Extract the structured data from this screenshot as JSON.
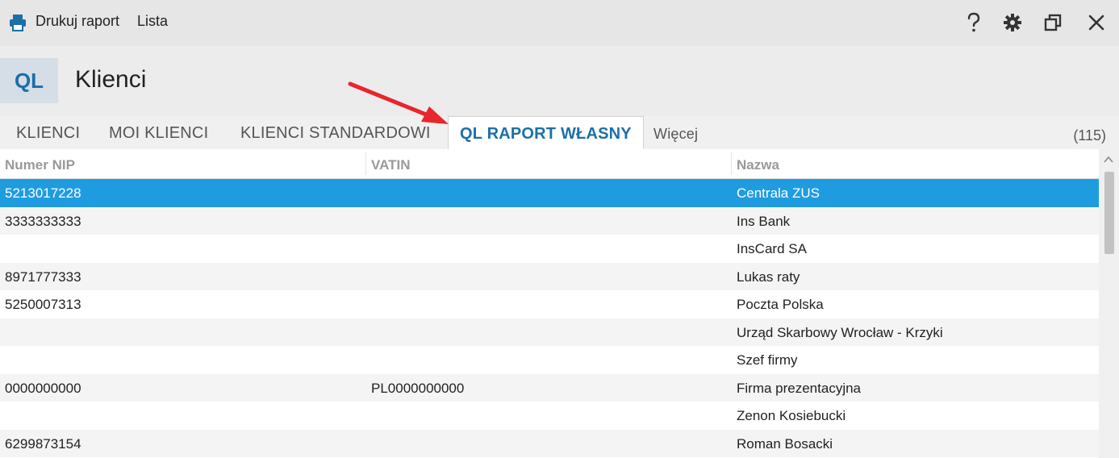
{
  "toolbar": {
    "print_label": "Drukuj raport",
    "list_label": "Lista",
    "print_icon": "printer-icon",
    "help_icon": "help-icon",
    "settings_icon": "gear-icon",
    "restore_icon": "restore-window-icon",
    "close_icon": "close-icon"
  },
  "header": {
    "badge": "QL",
    "title": "Klienci"
  },
  "tabs": {
    "items": [
      "KLIENCI",
      "MOI KLIENCI",
      "KLIENCI STANDARDOWI",
      "QL RAPORT WŁASNY"
    ],
    "active_index": 3,
    "more_label": "Więcej",
    "count": "(115)"
  },
  "table": {
    "columns": [
      "Numer NIP",
      "VATIN",
      "Nazwa"
    ],
    "rows": [
      {
        "nip": "5213017228",
        "vatin": "",
        "name": "Centrala ZUS",
        "selected": true
      },
      {
        "nip": "3333333333",
        "vatin": "",
        "name": "Ins Bank"
      },
      {
        "nip": "",
        "vatin": "",
        "name": "InsCard SA"
      },
      {
        "nip": "8971777333",
        "vatin": "",
        "name": "Lukas raty"
      },
      {
        "nip": "5250007313",
        "vatin": "",
        "name": "Poczta Polska"
      },
      {
        "nip": "",
        "vatin": "",
        "name": "Urząd Skarbowy Wrocław - Krzyki"
      },
      {
        "nip": "",
        "vatin": "",
        "name": "Szef firmy"
      },
      {
        "nip": "0000000000",
        "vatin": "PL0000000000",
        "name": "Firma prezentacyjna"
      },
      {
        "nip": "",
        "vatin": "",
        "name": "Zenon Kosiebucki"
      },
      {
        "nip": "6299873154",
        "vatin": "",
        "name": "Roman Bosacki"
      }
    ]
  },
  "colors": {
    "accent": "#1d6fa8",
    "selection": "#1f9ce0",
    "annotation_arrow": "#e8262b"
  }
}
